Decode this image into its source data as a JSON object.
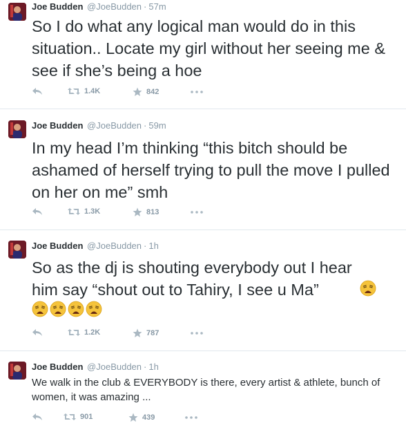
{
  "tweets": [
    {
      "name": "Joe Budden",
      "handle": "@JoeBudden",
      "time": "57m",
      "text": "So I do what any logical man would do in this situation.. Locate my girl without her seeing me & see if she’s being a hoe",
      "retweets": "1.4K",
      "favorites": "842"
    },
    {
      "name": "Joe Budden",
      "handle": "@JoeBudden",
      "time": "59m",
      "text": "In my head I’m thinking “this bitch should be ashamed of herself trying to pull the move I pulled on her on me” smh",
      "retweets": "1.3K",
      "favorites": "813"
    },
    {
      "name": "Joe Budden",
      "handle": "@JoeBudden",
      "time": "1h",
      "text": "So as the dj is shouting everybody out I hear him say “shout out to Tahiry, I see u Ma”",
      "emoji": "weary-face",
      "retweets": "1.2K",
      "favorites": "787"
    },
    {
      "name": "Joe Budden",
      "handle": "@JoeBudden",
      "time": "1h",
      "text": "We walk in the club & EVERYBODY is there, every artist & athlete, bunch of women, it was amazing ...",
      "retweets": "901",
      "favorites": "439"
    }
  ],
  "separator": "·",
  "icons": {
    "reply": "reply-icon",
    "retweet": "retweet-icon",
    "favorite": "star-icon",
    "more": "more-icon"
  },
  "colors": {
    "text": "#292f33",
    "muted": "#8899a6",
    "border": "#e1e8ed",
    "emoji": "#f5c33b"
  }
}
